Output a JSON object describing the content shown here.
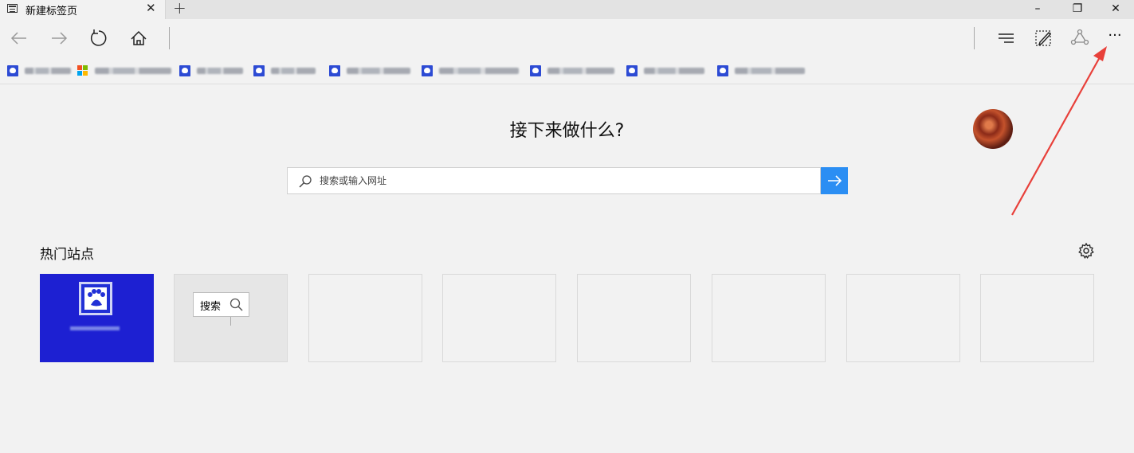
{
  "tabs": [
    {
      "title": "新建标签页",
      "icon": "page-icon",
      "close_label": "✕"
    }
  ],
  "new_tab_label": "+",
  "window_controls": {
    "minimize": "–",
    "restore": "❐",
    "close": "✕"
  },
  "toolbar": {
    "back_icon": "back-arrow-icon",
    "forward_icon": "forward-arrow-icon",
    "refresh_icon": "refresh-icon",
    "home_icon": "home-icon",
    "hub_icon": "hub-icon",
    "web_note_icon": "web-note-icon",
    "share_icon": "share-icon",
    "more_label": "···"
  },
  "favorites": [
    {
      "icon": "baidu-paw-icon",
      "label": ""
    },
    {
      "icon": "windows-logo-icon",
      "label": ""
    },
    {
      "icon": "baidu-paw-icon",
      "label": ""
    },
    {
      "icon": "baidu-paw-icon",
      "label": ""
    },
    {
      "icon": "baidu-paw-icon",
      "label": ""
    },
    {
      "icon": "baidu-paw-icon",
      "label": ""
    },
    {
      "icon": "baidu-paw-icon",
      "label": ""
    },
    {
      "icon": "baidu-paw-icon",
      "label": ""
    },
    {
      "icon": "baidu-paw-icon",
      "label": ""
    }
  ],
  "main": {
    "headline": "接下来做什么?",
    "search_placeholder": "搜索或输入网址",
    "search_go_icon": "arrow-right-icon",
    "section_title": "热门站点",
    "settings_icon": "gear-icon"
  },
  "top_sites": [
    {
      "type": "baidu",
      "label": ""
    },
    {
      "type": "search",
      "label": "搜索"
    },
    {
      "type": "empty"
    },
    {
      "type": "empty"
    },
    {
      "type": "empty"
    },
    {
      "type": "empty"
    },
    {
      "type": "empty"
    },
    {
      "type": "empty"
    }
  ],
  "colors": {
    "accent": "#2b8ef3",
    "baidu_tile": "#1d20d2",
    "annotation_arrow": "#e8403a"
  }
}
